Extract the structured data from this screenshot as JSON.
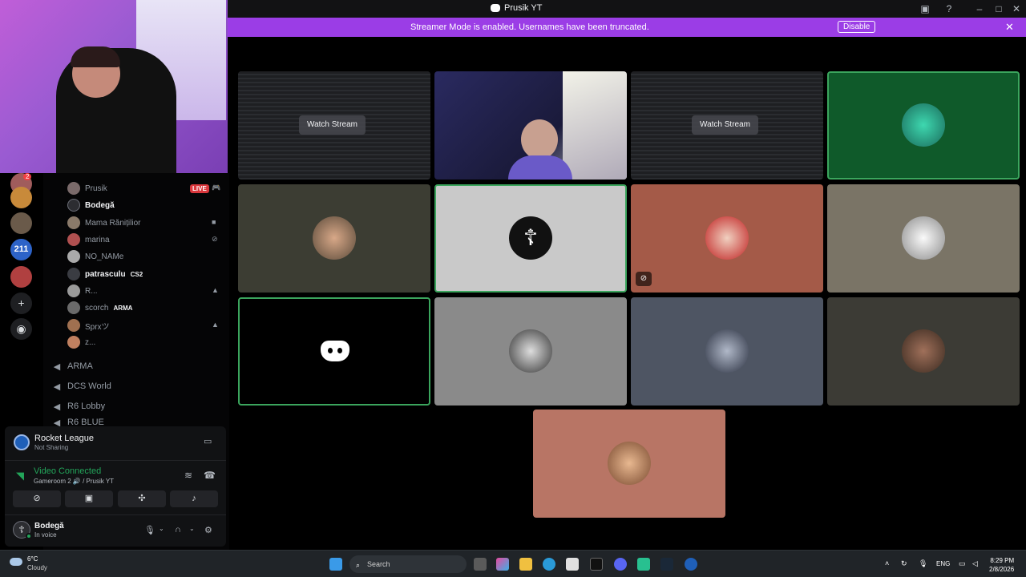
{
  "window": {
    "title": "Prusik YT"
  },
  "banner": {
    "text": "Streamer Mode is enabled. Usernames have been truncated.",
    "button": "Disable"
  },
  "server_badge": "2",
  "server_tag": "211",
  "voice_members": [
    {
      "name": "Prusik",
      "bold": false,
      "live": "LIVE"
    },
    {
      "name": "Bodegă",
      "bold": true
    },
    {
      "name": "Mama Rănițilior",
      "bold": false
    },
    {
      "name": "marina",
      "bold": false
    },
    {
      "name": "NO_NAMe",
      "bold": false
    },
    {
      "name": "patrasculu",
      "bold": true,
      "tag": "CS2"
    },
    {
      "name": "R...",
      "bold": false
    },
    {
      "name": "scorch",
      "bold": false,
      "tag": "ARMA"
    },
    {
      "name": "Sprxツ",
      "bold": false
    },
    {
      "name": "z...",
      "bold": false
    }
  ],
  "channels": [
    {
      "name": "ARMA"
    },
    {
      "name": "DCS World"
    },
    {
      "name": "R6 Lobby"
    },
    {
      "name": "R6 BLUE"
    }
  ],
  "activity": {
    "title": "Rocket League",
    "subtitle": "Not Sharing"
  },
  "voice": {
    "status": "Video Connected",
    "location": "Gameroom 2 🔊 / Prusik YT"
  },
  "user": {
    "name": "Bodegă",
    "status": "In voice"
  },
  "stage": {
    "watch_label": "Watch Stream"
  },
  "taskbar": {
    "temp": "6°C",
    "weather": "Cloudy",
    "search": "Search",
    "lang": "ENG",
    "time": "8:29 PM",
    "date": "2/8/2026"
  },
  "colors": {
    "accent": "#9b3de6",
    "connected": "#23a55a",
    "live": "#da373c"
  }
}
